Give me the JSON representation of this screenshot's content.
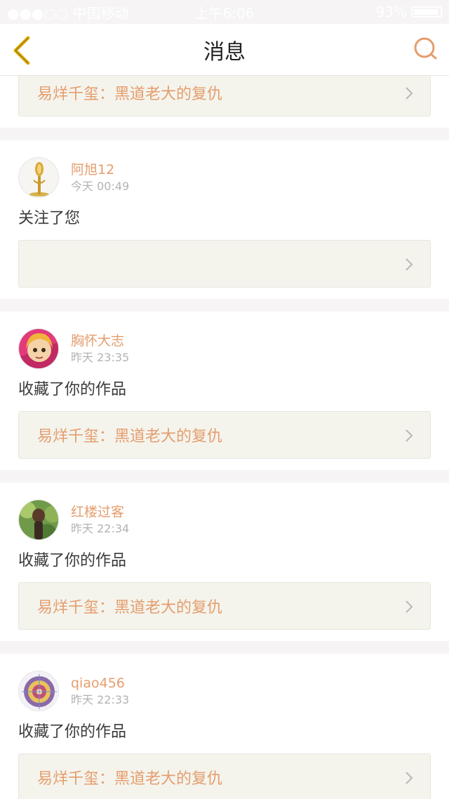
{
  "status_bar": {
    "carrier": "●●●○○ 中国移动",
    "time": "上午6:06",
    "battery": "93%"
  },
  "header": {
    "title": "消息"
  },
  "messages": [
    {
      "work_title": "易烊千玺：黑道老大的复仇"
    },
    {
      "username": "阿旭12",
      "time": "今天 00:49",
      "action": "关注了您",
      "work_title": ""
    },
    {
      "username": "胸怀大志",
      "time": "昨天 23:35",
      "action": "收藏了你的作品",
      "work_title": "易烊千玺：黑道老大的复仇"
    },
    {
      "username": "红楼过客",
      "time": "昨天 22:34",
      "action": "收藏了你的作品",
      "work_title": "易烊千玺：黑道老大的复仇"
    },
    {
      "username": "qiao456",
      "time": "昨天 22:33",
      "action": "收藏了你的作品",
      "work_title": "易烊千玺：黑道老大的复仇"
    }
  ],
  "colors": {
    "accent": "#e59d6d",
    "back_icon": "#e4b30f",
    "card_bg": "#f4f4ed"
  },
  "icons": {
    "back": "chevron-left-icon",
    "search": "search-icon",
    "row_arrow": "chevron-right-icon"
  }
}
